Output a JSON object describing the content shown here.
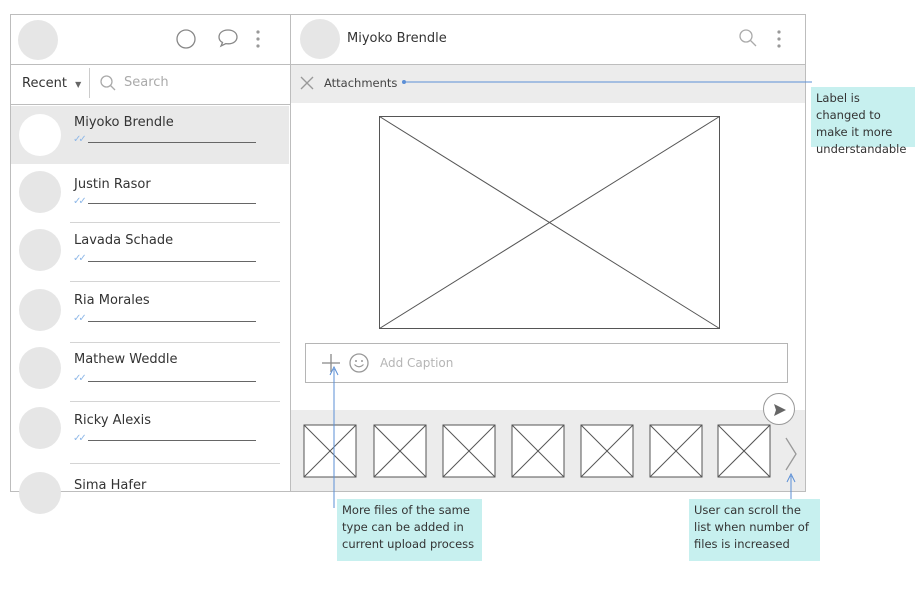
{
  "sidebar": {
    "sort_label": "Recent",
    "search_placeholder": "Search",
    "contacts": [
      {
        "name": "Miyoko Brendle"
      },
      {
        "name": "Justin Rasor"
      },
      {
        "name": "Lavada Schade"
      },
      {
        "name": "Ria Morales"
      },
      {
        "name": "Mathew Weddle"
      },
      {
        "name": "Ricky Alexis"
      },
      {
        "name": "Sima Hafer"
      }
    ]
  },
  "chat": {
    "contact_name": "Miyoko Brendle",
    "attachments_label": "Attachments",
    "caption_placeholder": "Add Caption"
  },
  "annotations": {
    "label_note": "Label is changed to make it more understandable",
    "add_files_note": "More files of the same type can be added in current upload process",
    "scroll_note": "User can scroll the list when number of files is increased"
  },
  "colors": {
    "annotation_bg": "#c7f0ef",
    "annotation_line": "#5b8fd6",
    "read_check": "#8fb8e8"
  }
}
